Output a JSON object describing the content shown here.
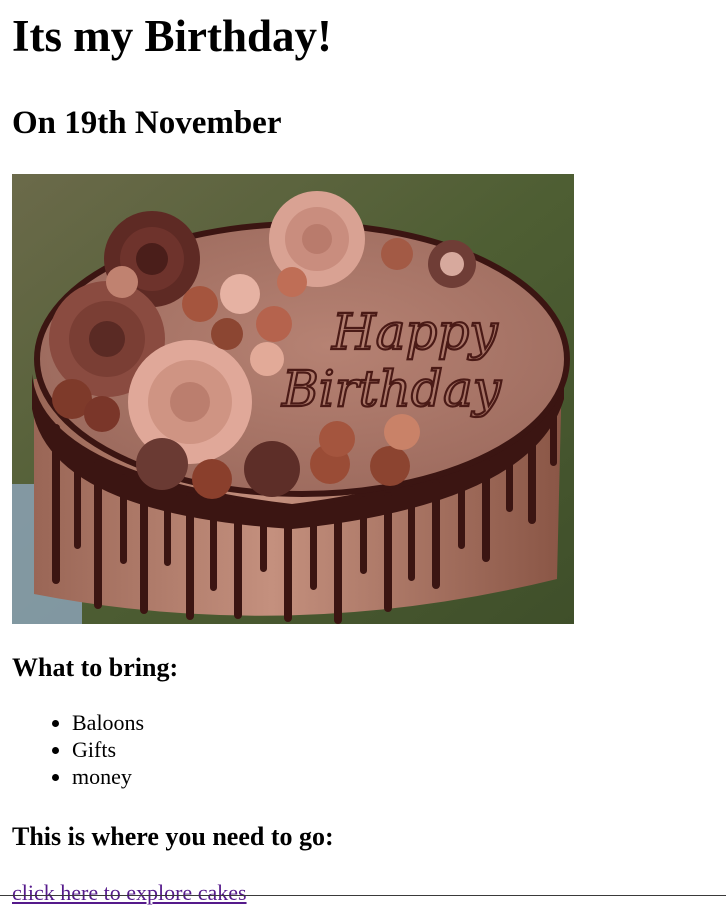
{
  "header": {
    "title": "Its my Birthday!",
    "date_line": "On 19th November"
  },
  "image": {
    "cake_text_line1": "Happy",
    "cake_text_line2": "Birthday"
  },
  "bring": {
    "heading": "What to bring:",
    "items": [
      "Baloons",
      "Gifts",
      "money"
    ]
  },
  "directions": {
    "heading": "This is where you need to go:",
    "link_text": "click here to explore cakes"
  },
  "colors": {
    "link_visited": "#551a8b",
    "frosting": "#b0776a",
    "chocolate_drip": "#3b1512",
    "background_green": "#5b6a3c"
  }
}
